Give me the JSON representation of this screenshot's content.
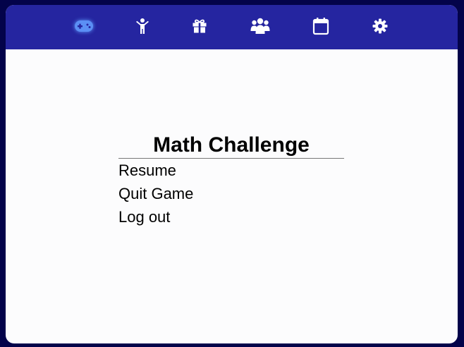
{
  "nav": {
    "items": [
      {
        "icon": "gamepad-icon",
        "active": true
      },
      {
        "icon": "person-icon",
        "active": false
      },
      {
        "icon": "gift-icon",
        "active": false
      },
      {
        "icon": "group-icon",
        "active": false
      },
      {
        "icon": "calendar-icon",
        "active": false
      },
      {
        "icon": "gear-icon",
        "active": false
      }
    ]
  },
  "menu": {
    "title": "Math Challenge",
    "items": [
      {
        "label": "Resume"
      },
      {
        "label": "Quit Game"
      },
      {
        "label": "Log out"
      }
    ]
  },
  "colors": {
    "background": "#03034a",
    "topbar": "#2525a0",
    "panel": "#fcfcfd",
    "active_icon": "#5b8ff5",
    "icon": "#ffffff"
  }
}
